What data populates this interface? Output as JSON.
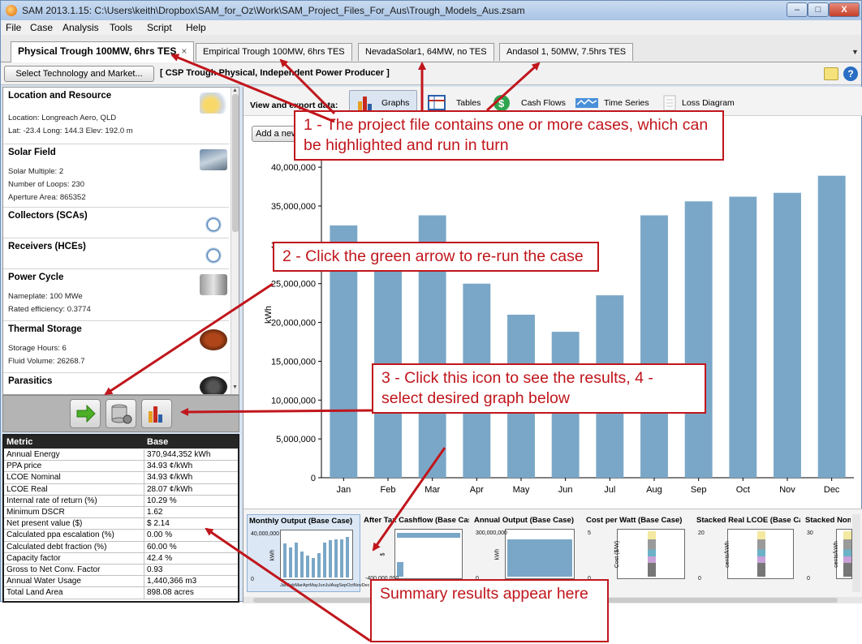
{
  "window": {
    "title": "SAM 2013.1.15: C:\\Users\\keith\\Dropbox\\SAM_for_Oz\\Work\\SAM_Project_Files_For_Aus\\Trough_Models_Aus.zsam",
    "minimize": "–",
    "maximize": "□",
    "close": "X"
  },
  "menu": [
    "File",
    "Case",
    "Analysis",
    "Tools",
    "Script",
    "Help"
  ],
  "case_tabs": [
    {
      "label": "Physical Trough 100MW, 6hrs TES",
      "active": true
    },
    {
      "label": "Empirical Trough 100MW, 6hrs TES",
      "active": false
    },
    {
      "label": "NevadaSolar1, 64MW, no TES",
      "active": false
    },
    {
      "label": "Andasol 1, 50MW, 7.5hrs TES",
      "active": false
    }
  ],
  "tab_close": "×",
  "tab_menu": "▼",
  "toolbar": {
    "select_tech": "Select Technology and Market...",
    "tech_label": "[ CSP Trough Physical, Independent Power Producer ]",
    "help": "?"
  },
  "sidebar": {
    "location": {
      "title": "Location and Resource",
      "lines": [
        "Location: Longreach Aero, QLD",
        "Lat: -23.4  Long: 144.3  Elev: 192.0 m"
      ]
    },
    "solar_field": {
      "title": "Solar Field",
      "lines": [
        "Solar Multiple: 2",
        "Number of Loops: 230",
        "Aperture Area: 865352"
      ]
    },
    "collectors": {
      "title": "Collectors (SCAs)"
    },
    "receivers": {
      "title": "Receivers (HCEs)"
    },
    "power_cycle": {
      "title": "Power Cycle",
      "lines": [
        "Nameplate: 100 MWe",
        "Rated efficiency: 0.3774"
      ]
    },
    "thermal_storage": {
      "title": "Thermal Storage",
      "lines": [
        "Storage Hours: 6",
        "Fluid Volume: 26268.7"
      ]
    },
    "parasitics": {
      "title": "Parasitics"
    }
  },
  "summary": {
    "header_metric": "Metric",
    "header_base": "Base",
    "rows": [
      {
        "metric": "Annual Energy",
        "value": "370,944,352 kWh"
      },
      {
        "metric": "PPA price",
        "value": "34.93 ¢/kWh"
      },
      {
        "metric": "LCOE Nominal",
        "value": "34.93 ¢/kWh"
      },
      {
        "metric": "LCOE Real",
        "value": "28.07 ¢/kWh"
      },
      {
        "metric": "Internal rate of return (%)",
        "value": "10.29 %"
      },
      {
        "metric": "Minimum DSCR",
        "value": "1.62"
      },
      {
        "metric": "Net present value ($)",
        "value": "$ 2.14"
      },
      {
        "metric": "Calculated ppa escalation (%)",
        "value": "0.00 %"
      },
      {
        "metric": "Calculated debt fraction (%)",
        "value": "60.00 %"
      },
      {
        "metric": "Capacity factor",
        "value": "42.4 %"
      },
      {
        "metric": "Gross to Net Conv. Factor",
        "value": "0.93"
      },
      {
        "metric": "Annual Water Usage",
        "value": "1,440,366 m3"
      },
      {
        "metric": "Total Land Area",
        "value": "898.08 acres"
      }
    ]
  },
  "export": {
    "label": "View and export data:",
    "graphs": "Graphs",
    "tables": "Tables",
    "cash_flows": "Cash Flows",
    "time_series": "Time Series",
    "loss_diagram": "Loss Diagram",
    "add_graph": "Add a new graph"
  },
  "chart_data": {
    "type": "bar",
    "ylabel": "kWh",
    "ylim": [
      0,
      42000000
    ],
    "yticks": [
      "0",
      "5,000,000",
      "10,000,000",
      "15,000,000",
      "20,000,000",
      "25,000,000",
      "30,000,000",
      "35,000,000",
      "40,000,000"
    ],
    "grid": false,
    "categories": [
      "Jan",
      "Feb",
      "Mar",
      "Apr",
      "May",
      "Jun",
      "Jul",
      "Aug",
      "Sep",
      "Oct",
      "Nov",
      "Dec"
    ],
    "values": [
      32500000,
      29000000,
      33800000,
      25000000,
      21000000,
      18800000,
      23500000,
      33800000,
      35600000,
      36200000,
      36700000,
      38900000
    ],
    "bar_color": "#7aa7c7"
  },
  "thumbnails": [
    {
      "title": "Monthly Output (Base Case)",
      "ylabel": "kWh",
      "ytop": "40,000,000",
      "ybottom": "0",
      "xlabels": "JanFebMarAprMayJunJulAugSepOctNovDec"
    },
    {
      "title": "After Tax Cashflow (Base Case)",
      "ylabel": "$",
      "ytop": "",
      "ybottom": "-400,000,000"
    },
    {
      "title": "Annual Output (Base Case)",
      "ylabel": "kWh",
      "ytop": "300,000,000",
      "ybottom": "0"
    },
    {
      "title": "Cost per Watt (Base Case)",
      "ylabel": "Cost ($/W)",
      "ytop": "5",
      "ybottom": "0"
    },
    {
      "title": "Stacked Real LCOE (Base Case)",
      "ylabel": "cents/kWh",
      "ytop": "20",
      "ybottom": "0"
    },
    {
      "title": "Stacked Nominal LCOE",
      "ylabel": "cents/kWh",
      "ytop": "30",
      "ybottom": "0"
    }
  ],
  "callouts": {
    "c1": "1 - The project file contains one or more cases, which can be highlighted and run in turn",
    "c2": "2 - Click the green arrow to re-run the case",
    "c3": "3 - Click this icon to see the results, 4 - select desired graph below",
    "c4": "Summary results appear here"
  },
  "colors": {
    "annotation": "#c0161c",
    "bar": "#7aa7c7",
    "window_frame": "#d6e3f2"
  }
}
